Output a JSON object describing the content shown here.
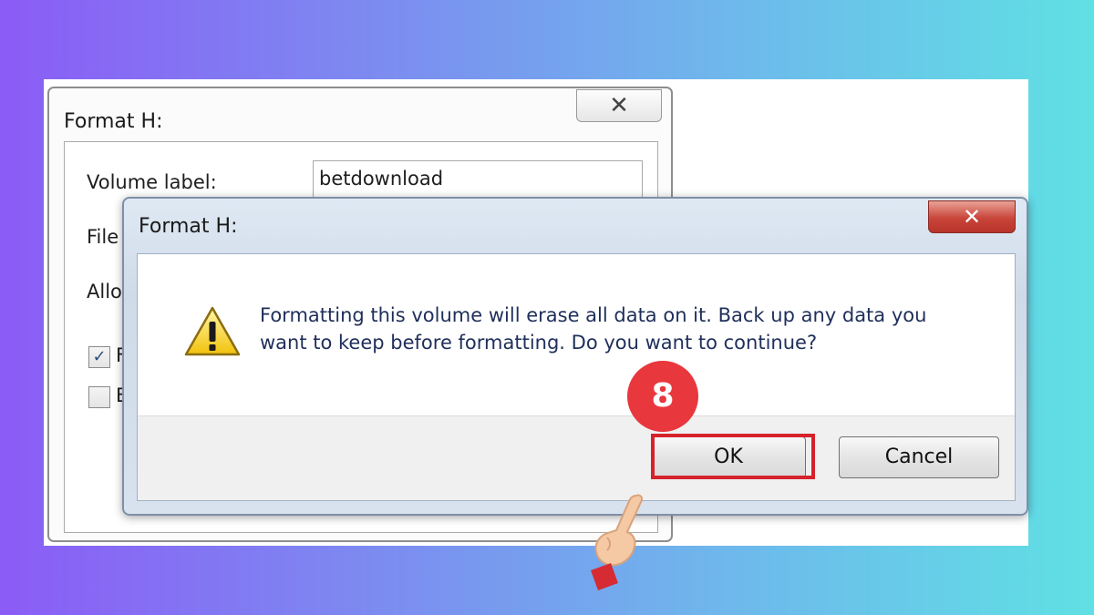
{
  "back_dialog": {
    "title": "Format H:",
    "close_symbol": "✕",
    "volume_label": "Volume label:",
    "volume_value": "betdownload",
    "file_system_label_partial": "File s",
    "allocation_label_partial": "Alloc",
    "checkbox1": {
      "checked": true,
      "label_partial": "F"
    },
    "checkbox2": {
      "checked": false,
      "label_partial": "E"
    }
  },
  "front_dialog": {
    "title": "Format H:",
    "close_symbol": "✕",
    "icon": "warning-icon",
    "message_line1": "Formatting this volume will erase all data on it. Back up any data you",
    "message_line2": "want to keep before formatting. Do you want to continue?",
    "ok_label": "OK",
    "cancel_label": "Cancel"
  },
  "annotation": {
    "step_number": "8",
    "highlight_color": "#d6222b",
    "pointer": "pointing-hand-icon"
  }
}
